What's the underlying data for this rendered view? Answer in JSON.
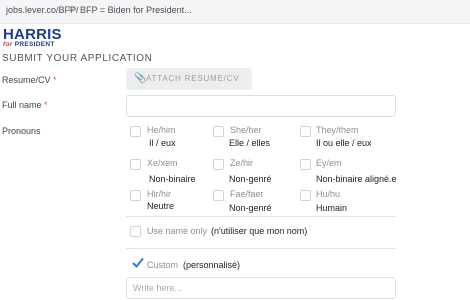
{
  "browser": {
    "url": "jobs.lever.co/BFP/",
    "separator": "⇦",
    "note": "BFP = Biden for President..."
  },
  "logo": {
    "name": "HARRIS",
    "for": "for",
    "role": "PRESIDENT"
  },
  "section_title": "SUBMIT YOUR APPLICATION",
  "form": {
    "resume_label": "Resume/CV",
    "resume_required": "*",
    "attach_label": "ATTACH RESUME/CV",
    "fullname_label": "Full name",
    "fullname_required": "*",
    "fullname_value": "",
    "pronouns_label": "Pronouns",
    "pronoun_options": [
      {
        "primary": "He/him",
        "translation": "Il / eux"
      },
      {
        "primary": "She/her",
        "translation": "Elle / elles"
      },
      {
        "primary": "They/them",
        "translation": "Il ou elle / eux"
      },
      {
        "primary": "Xe/xem",
        "translation": "Non-binaire"
      },
      {
        "primary": "Ze/hir",
        "translation": "Non-genré"
      },
      {
        "primary": "Ey/em",
        "translation": "Non-binaire aligné.e"
      },
      {
        "primary": "Hir/hir",
        "translation": "Neutre"
      },
      {
        "primary": "Fae/faer",
        "translation": "Non-genré"
      },
      {
        "primary": "Hu/hu",
        "translation": "Humain"
      }
    ],
    "use_name_only": {
      "primary": "Use name only",
      "translation": "(n'utiliser que mon nom)"
    },
    "custom": {
      "primary": "Custom",
      "translation": "(personnalisé)",
      "checked": true
    },
    "custom_placeholder": "Write here..."
  },
  "colors": {
    "brand_blue": "#1a3d8f",
    "brand_red": "#d6303a",
    "check_blue": "#2a7fd4",
    "required_red": "#e05a48"
  }
}
